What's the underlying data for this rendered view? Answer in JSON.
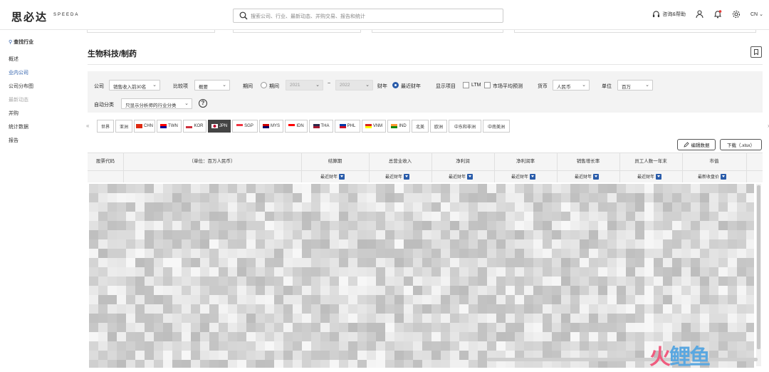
{
  "header": {
    "logo": "思必达",
    "logo_sub": "SPEEDA",
    "search_placeholder": "搜索公司、行业、最新动态、并购交易、报告和统计",
    "help_label": "咨询&帮助",
    "lang_label": "CN"
  },
  "sidebar": {
    "search_label": "查找行业",
    "items": [
      {
        "label": "概述",
        "state": "normal"
      },
      {
        "label": "业内公司",
        "state": "active"
      },
      {
        "label": "公司分布图",
        "state": "normal"
      },
      {
        "label": "最新动态",
        "state": "dim"
      },
      {
        "label": "并购",
        "state": "normal"
      },
      {
        "label": "统计数据",
        "state": "normal"
      },
      {
        "label": "报告",
        "state": "normal"
      }
    ]
  },
  "page": {
    "title": "生物科技/制药"
  },
  "filters": {
    "company_label": "公司",
    "company_value": "销售收入前30名",
    "compare_label": "比较项",
    "compare_value": "概要",
    "period_label": "期间",
    "period_option": "期间",
    "period_from": "2021",
    "period_to": "2022",
    "fiscal_label": "财年",
    "recent_fy_label": "最近财年",
    "display_label": "显示项目",
    "ltm_label": "LTM",
    "consensus_label": "市场平均预测",
    "currency_label": "货币",
    "currency_value": "人民币",
    "unit_label": "单位",
    "unit_value": "百万",
    "auto_class_label": "自动分类",
    "auto_class_value": "只显示分析师的行业分类",
    "help_icon": "?"
  },
  "regions": [
    {
      "label": "世界",
      "flag": ""
    },
    {
      "label": "亚洲",
      "flag": ""
    },
    {
      "label": "CHN",
      "flag": "chn"
    },
    {
      "label": "TWN",
      "flag": "twn"
    },
    {
      "label": "KOR",
      "flag": "kor"
    },
    {
      "label": "JPN",
      "flag": "jpn",
      "active": true
    },
    {
      "label": "SGP",
      "flag": "sgp"
    },
    {
      "label": "MYS",
      "flag": "mys"
    },
    {
      "label": "IDN",
      "flag": "idn"
    },
    {
      "label": "THA",
      "flag": "tha"
    },
    {
      "label": "PHL",
      "flag": "phl"
    },
    {
      "label": "VNM",
      "flag": "vnm"
    },
    {
      "label": "IND",
      "flag": "ind"
    },
    {
      "label": "北美",
      "flag": ""
    },
    {
      "label": "欧洲",
      "flag": ""
    },
    {
      "label": "中东和非洲",
      "flag": ""
    },
    {
      "label": "中南美洲",
      "flag": ""
    }
  ],
  "actions": {
    "edit_label": "编辑数据",
    "download_label": "下载（.xlsx）"
  },
  "table": {
    "columns": [
      "股票代码",
      "（单位：百万人民币）",
      "结算期",
      "总营业收入",
      "净利润",
      "净利润率",
      "销售增长率",
      "员工人数一年末",
      "市值"
    ],
    "subheaders": [
      "最近财年",
      "最近财年",
      "最近财年",
      "最近财年",
      "最近财年",
      "最近财年",
      "最新收盘价"
    ]
  },
  "watermark": {
    "part1": "火",
    "part2": "鲤鱼"
  },
  "colors": {
    "accent": "#2a5caa",
    "active_tab": "#444444"
  }
}
